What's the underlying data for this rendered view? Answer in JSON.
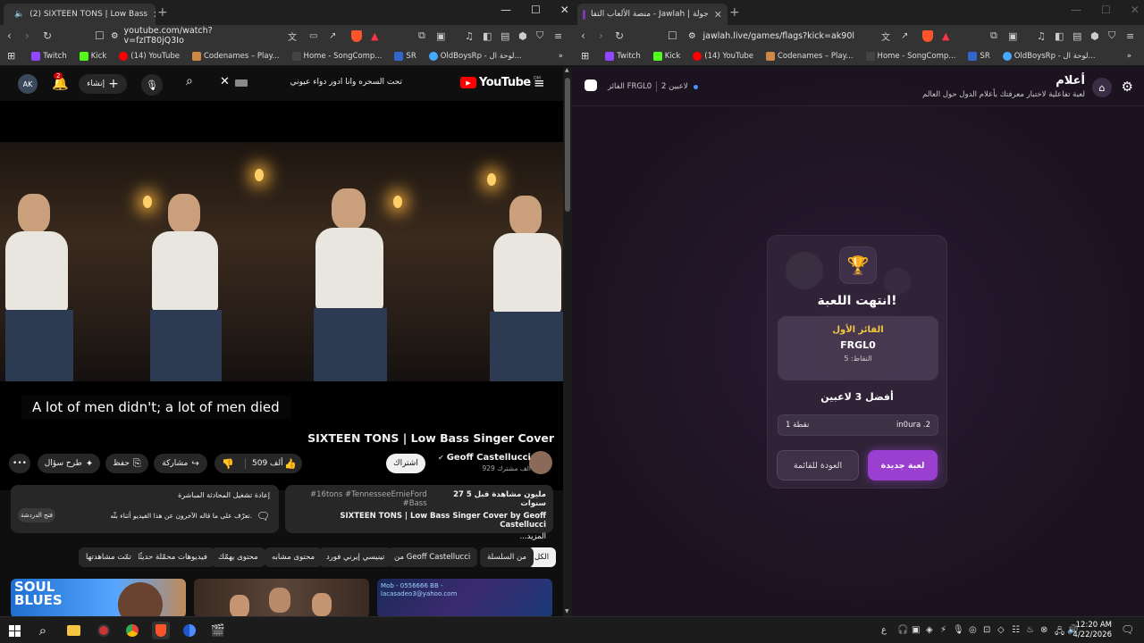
{
  "left_window": {
    "tab_title": "(2) SIXTEEN TONS | Low Bass",
    "url": "youtube.com/watch?v=fzIT80jQ3Io",
    "bookmarks": [
      "Twitch",
      "Kick",
      "(14) YouTube",
      "Codenames – Play...",
      "Home - SongComp...",
      "SR",
      "OldBoysRp - لوحة ال..."
    ],
    "more": "»",
    "youtube": {
      "logo": "YouTube",
      "logo_region": "OM",
      "search_value": "تحت السحره وانا ادور دواء عيوني",
      "notif_count": "2",
      "create_label": "إنشاء",
      "caption": "A lot of men didn't; a lot of men died",
      "video_title": "SIXTEEN TONS | Low Bass Singer Cover",
      "channel": "Geoff Castellucci",
      "subscribers": "929 ألف مشترك",
      "subscribe_label": "اشتراك",
      "likes": "509 ألف",
      "share_label": "مشاركة",
      "save_label": "حفظ",
      "ask_label": "طرح سؤال",
      "desc_stats": "27 مليون مشاهدة  قبل 5 سنوات",
      "desc_tags": "#16tons #TennesseeErnieFord #Bass",
      "desc_text": "SIXTEEN TONS | Low Bass Singer Cover by Geoff Castellucci",
      "desc_more": "...المزيد",
      "chat_title": "إعادة تشغيل المحادثة المباشرة",
      "chat_text": "تعرّف على ما قاله الآخرون عن هذا الفيديو أثناء بثّه.",
      "chat_button": "فتح الدردشة",
      "chips": [
        "الكل",
        "من السلسلة",
        "من Geoff Castellucci",
        "تينيسي إيرني فورد",
        "محتوى مشابه",
        "محتوى يهمّك",
        "فيديوهات محمّلة حديثًا",
        "تمّت مشاهدتها"
      ],
      "thumb1_text": "SOUL BLUES",
      "thumb3_text": "Mob - 0556666 BB - lacasadeo3@yahoo.com"
    }
  },
  "right_window": {
    "tab_title": "جولة | Jawlah - منصة الألعاب التفا",
    "url": "jawlah.live/games/flags?kick=ak90l",
    "bookmarks": [
      "Twitch",
      "Kick",
      "(14) YouTube",
      "Codenames – Play...",
      "Home - SongComp...",
      "SR",
      "OldBoysRp - لوحة ال..."
    ],
    "more": "»",
    "game": {
      "title": "أعلام",
      "subtitle": "لعبة تفاعلية لاختبار معرفتك بأعلام الدول حول العالم",
      "players_count": "2 لاعبين",
      "winner_tag": "الفائز FRGL0",
      "ended": "انتهت اللعبة!",
      "first_label": "الفائز الأول",
      "winner_name": "FRGL0",
      "points": "النقاط: 5",
      "top_title": "أفضل 3 لاعبين",
      "rank2_name": "in0ura .2",
      "rank2_points": "1 نقطة",
      "new_game": "لعبة جديدة",
      "back": "العودة للقائمة",
      "accent": "#9b3fd0"
    }
  },
  "taskbar": {
    "time": "12:20 AM",
    "date": "4/22/2026",
    "lang": "ع"
  }
}
